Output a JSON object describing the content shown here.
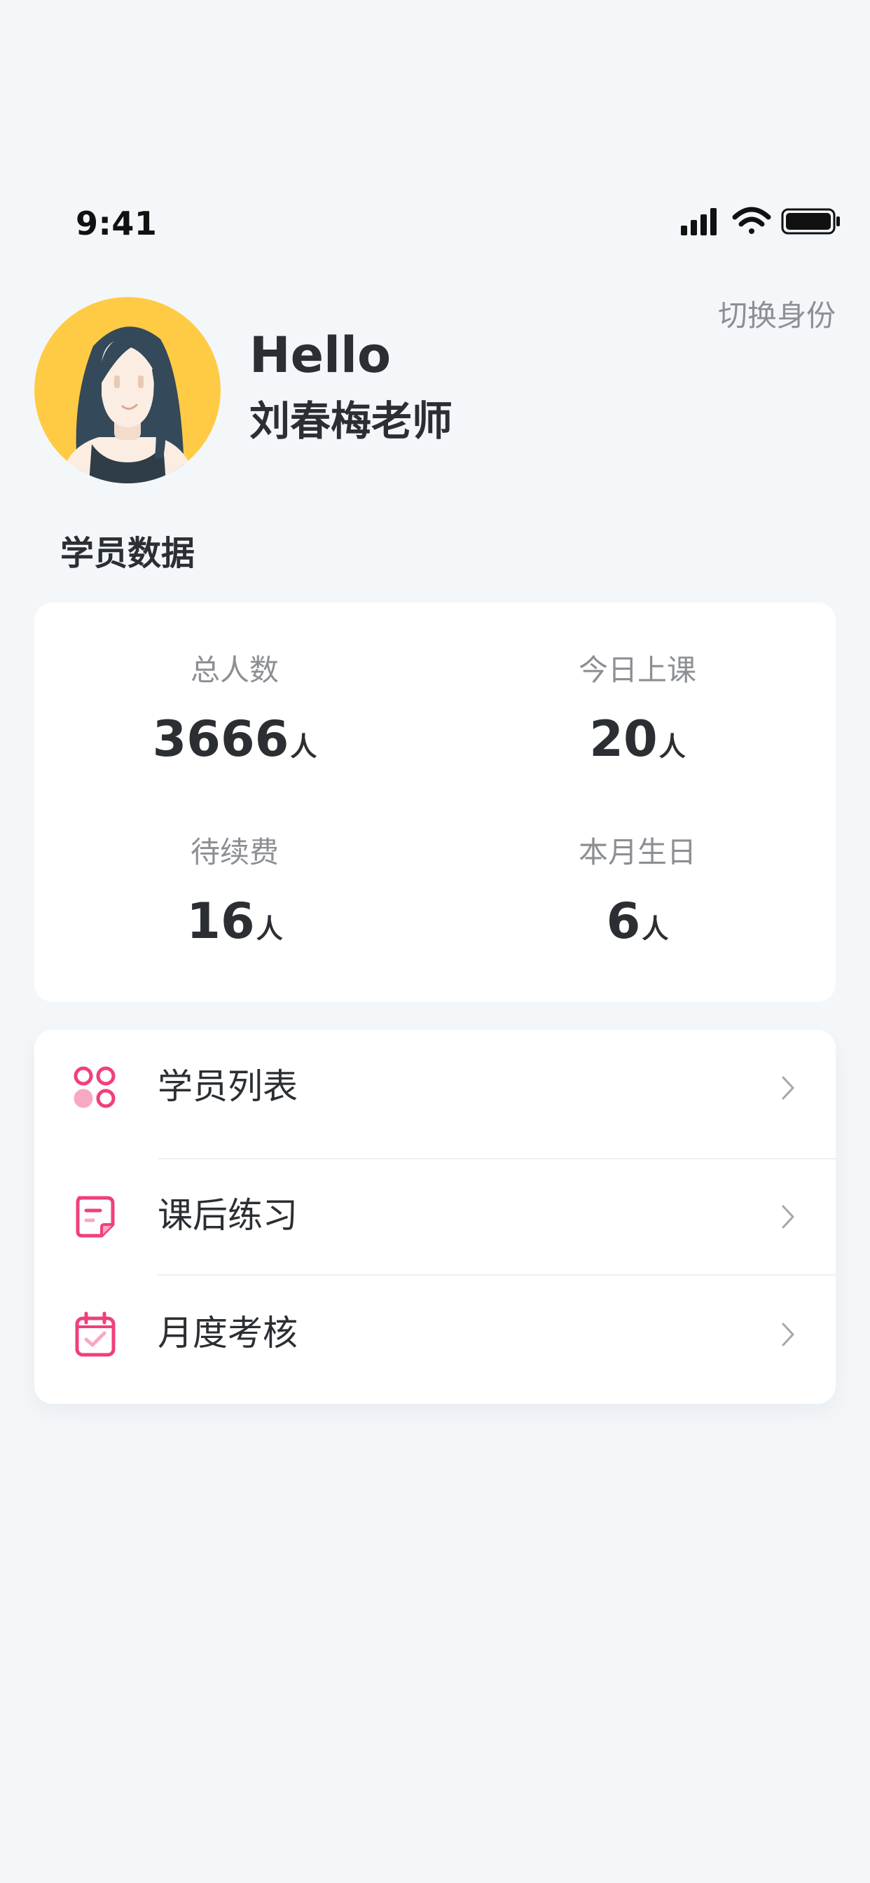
{
  "status_bar": {
    "time": "9:41"
  },
  "header": {
    "greeting": "Hello",
    "teacher_name": "刘春梅老师",
    "switch_identity_label": "切换身份"
  },
  "student_data": {
    "section_title": "学员数据",
    "stats": [
      {
        "label": "总人数",
        "value": "3666",
        "unit": "人"
      },
      {
        "label": "今日上课",
        "value": "20",
        "unit": "人"
      },
      {
        "label": "待续费",
        "value": "16",
        "unit": "人"
      },
      {
        "label": "本月生日",
        "value": "6",
        "unit": "人"
      }
    ]
  },
  "menu": {
    "items": [
      {
        "label": "学员列表",
        "icon": "student-list-icon"
      },
      {
        "label": "课后练习",
        "icon": "homework-icon"
      },
      {
        "label": "月度考核",
        "icon": "monthly-assessment-icon"
      }
    ]
  },
  "colors": {
    "background": "#F4F7F9",
    "card": "#FFFFFF",
    "accent_pink": "#F0407A",
    "avatar_bg": "#FFCB45",
    "text_primary": "#2B2F33",
    "text_secondary": "#8C8F94"
  }
}
